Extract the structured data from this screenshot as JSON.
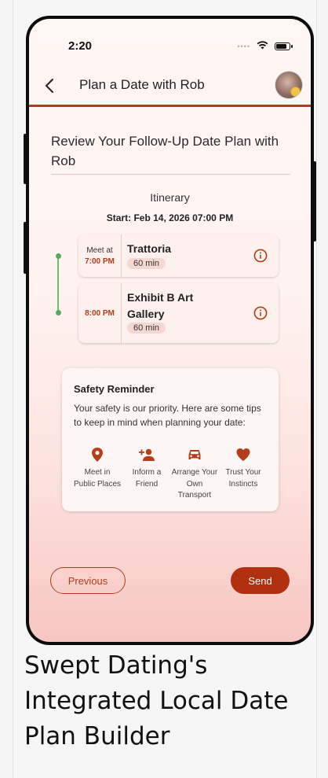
{
  "status_bar": {
    "time": "2:20",
    "signal_dots": "••••",
    "battery_level": 0.85
  },
  "header": {
    "title": "Plan a Date with Rob",
    "back_icon": "chevron-left-icon",
    "accent_color": "#b33d1c"
  },
  "page": {
    "title": "Review Your Follow-Up Date Plan with Rob",
    "itinerary_label": "Itinerary",
    "start": "Start: Feb 14, 2026 07:00 PM"
  },
  "stops": [
    {
      "meet_label": "Meet at",
      "time": "7:00 PM",
      "name": "Trattoria",
      "duration": "60 min"
    },
    {
      "meet_label": "",
      "time": "8:00 PM",
      "name": "Exhibit B Art Gallery",
      "duration": "60 min"
    }
  ],
  "safety": {
    "title": "Safety Reminder",
    "body": "Your safety is our priority. Here are some tips to keep in mind when planning your date:",
    "tips": [
      {
        "icon": "map-pin-icon",
        "label": "Meet in Public Places"
      },
      {
        "icon": "add-person-icon",
        "label": "Inform a Friend"
      },
      {
        "icon": "car-icon",
        "label": "Arrange Your Own Transport"
      },
      {
        "icon": "heart-icon",
        "label": "Trust Your Instincts"
      }
    ]
  },
  "actions": {
    "previous": "Previous",
    "send": "Send"
  },
  "caption": "Swept Dating's Integrated Local Date Plan Builder"
}
